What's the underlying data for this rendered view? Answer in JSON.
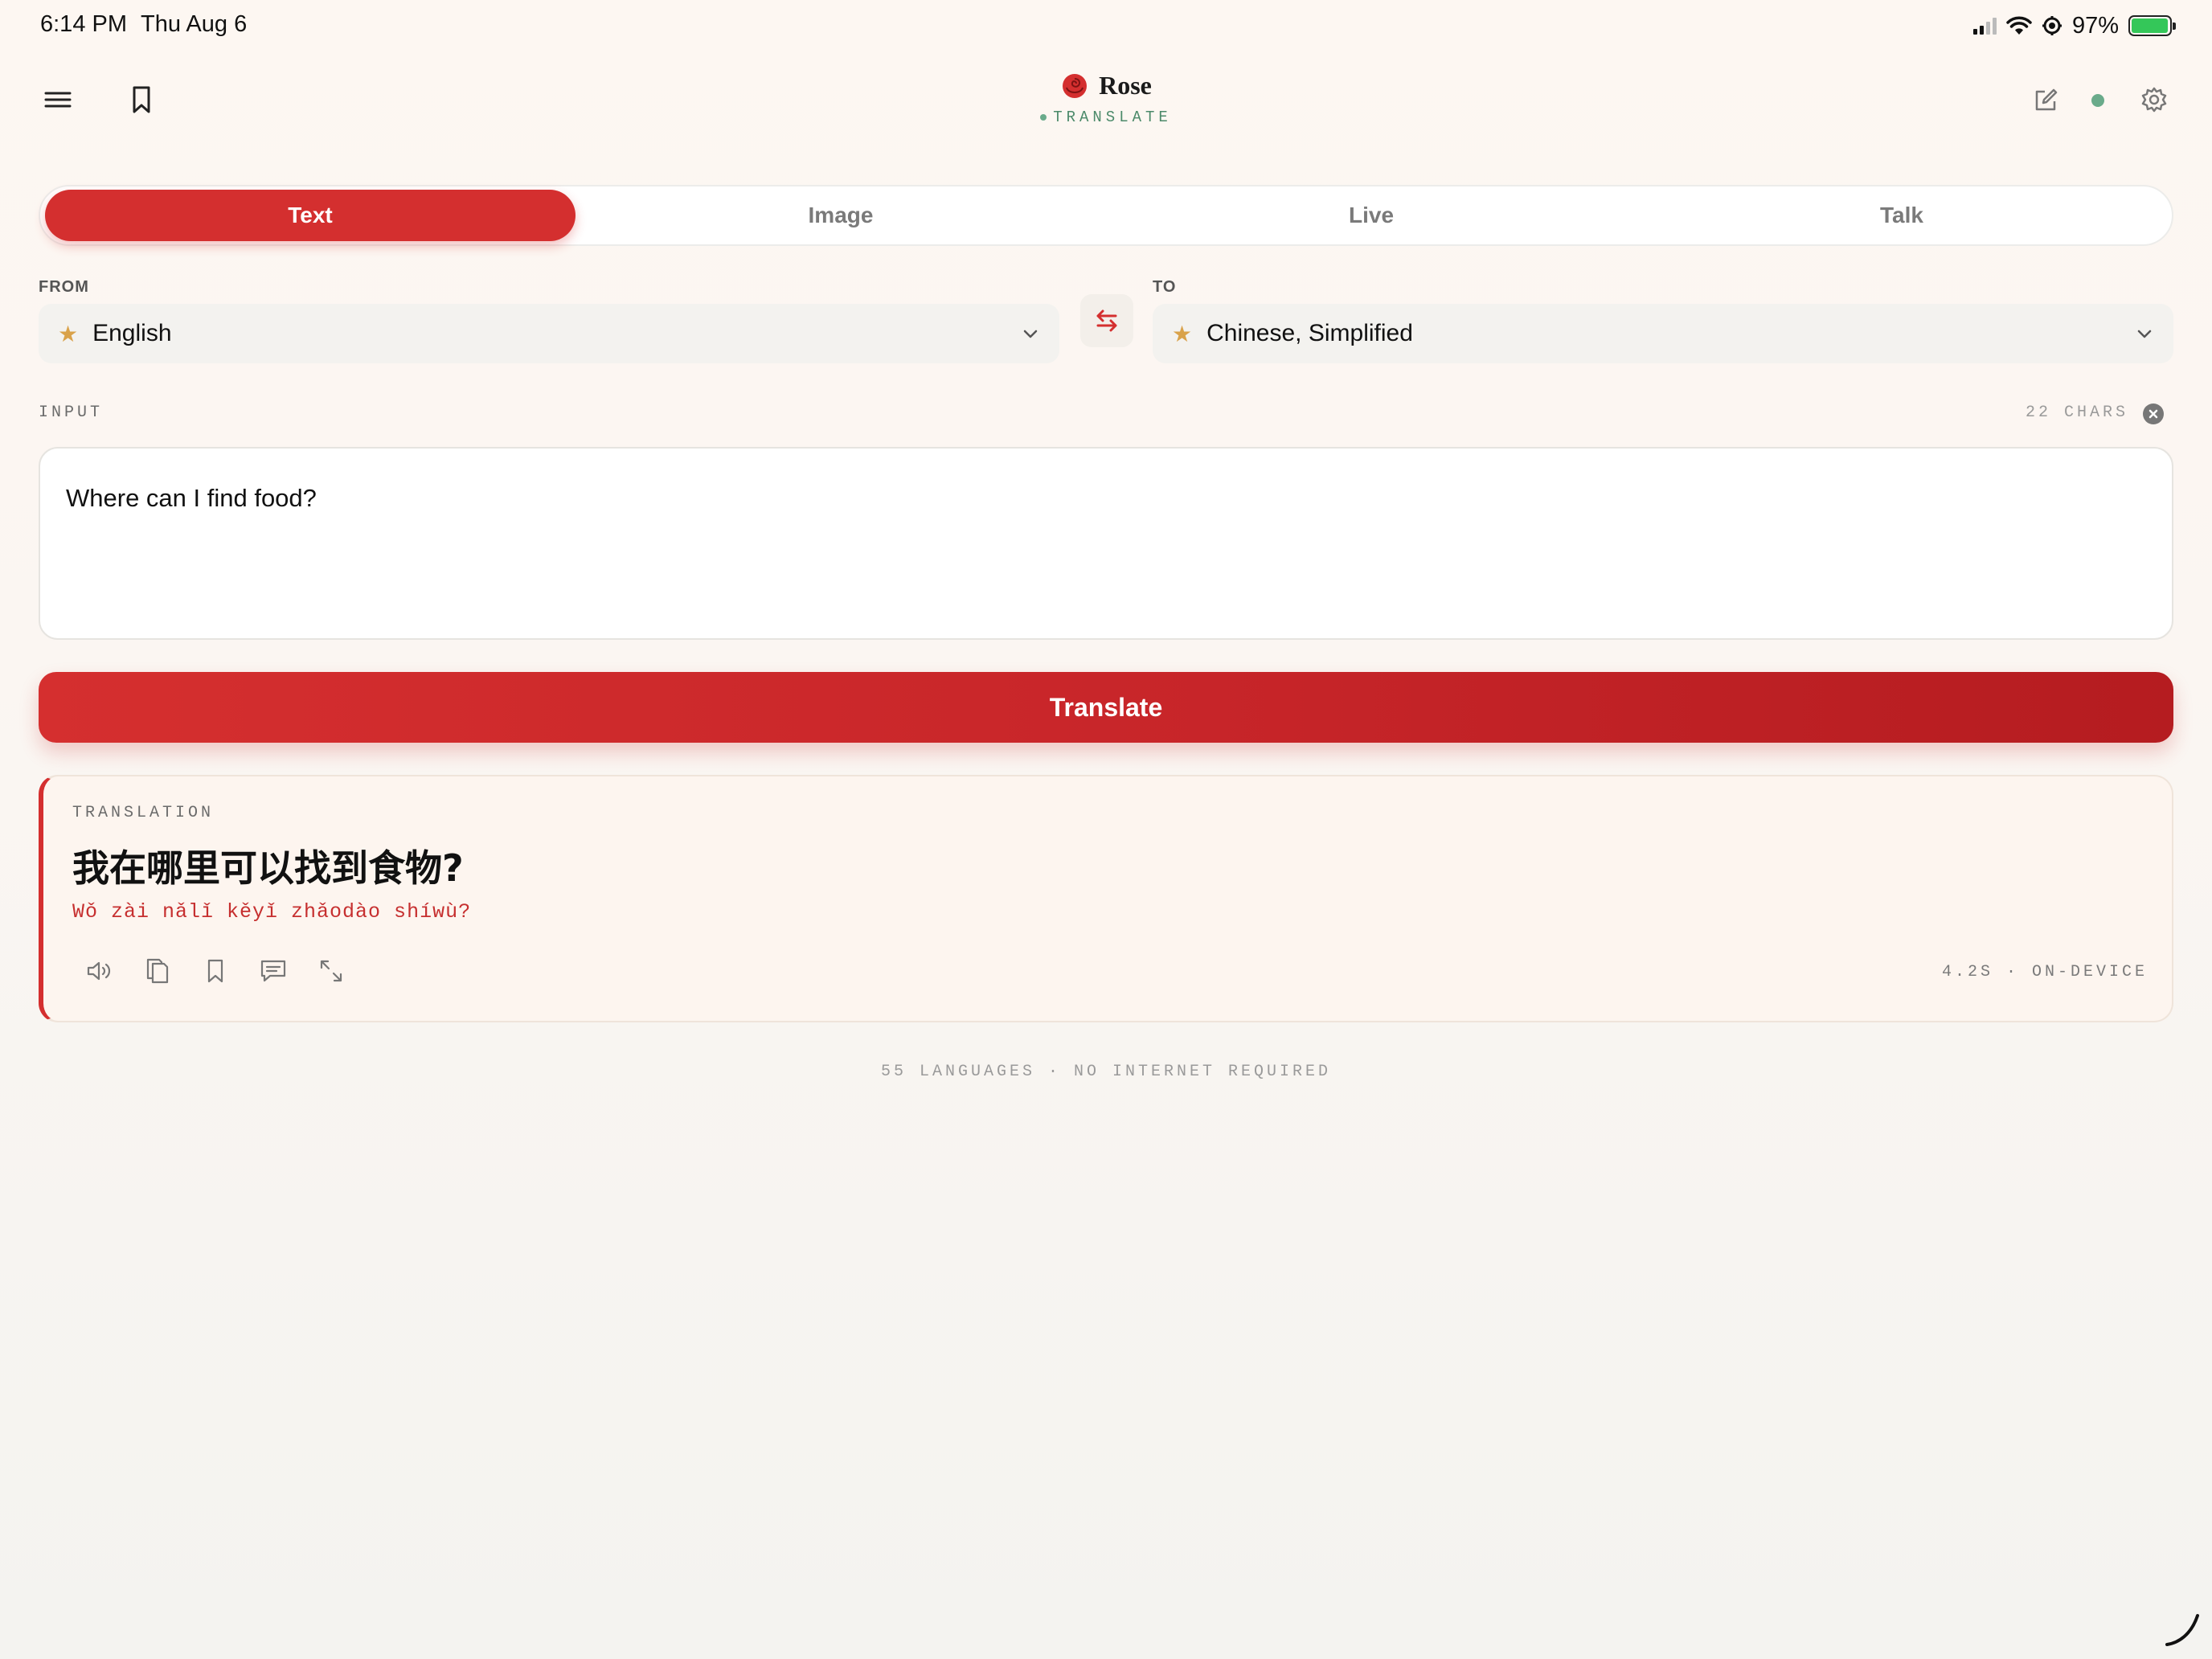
{
  "status_bar": {
    "time": "6:14 PM",
    "date": "Thu Aug 6",
    "battery_percent": "97%",
    "battery_level": 0.97,
    "icons": [
      "cellular-signal-icon",
      "wifi-icon",
      "focus-icon",
      "battery-charging-icon"
    ]
  },
  "header": {
    "brand_name": "Rose",
    "brand_subtitle": "TRANSLATE",
    "left_icons": [
      "menu-icon",
      "bookmark-icon"
    ],
    "right_icons": [
      "edit-icon",
      "status-dot-icon",
      "gear-icon"
    ]
  },
  "tabs": [
    {
      "label": "Text",
      "active": true
    },
    {
      "label": "Image",
      "active": false
    },
    {
      "label": "Live",
      "active": false
    },
    {
      "label": "Talk",
      "active": false
    }
  ],
  "languages": {
    "from_label": "FROM",
    "from_value": "English",
    "to_label": "TO",
    "to_value": "Chinese, Simplified"
  },
  "input": {
    "label": "INPUT",
    "char_count": "22 CHARS",
    "value": "Where can I find food?"
  },
  "translate_button": "Translate",
  "translation": {
    "label": "TRANSLATION",
    "result": "我在哪里可以找到食物?",
    "pinyin": "Wǒ zài nǎlǐ kěyǐ zhǎodào shíwù?",
    "meta": "4.2S · ON-DEVICE",
    "actions": [
      "speaker-icon",
      "copy-icon",
      "bookmark-icon",
      "comment-icon",
      "expand-icon"
    ]
  },
  "footer": "55 LANGUAGES · NO INTERNET REQUIRED",
  "colors": {
    "accent": "#d42f2f",
    "accent_dark": "#b51c20",
    "status_green": "#6aab8b",
    "star": "#d9a24a"
  }
}
